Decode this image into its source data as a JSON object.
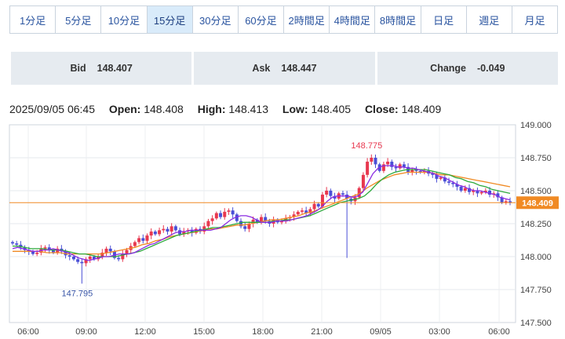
{
  "tabs": [
    {
      "label": "1分足",
      "active": false
    },
    {
      "label": "5分足",
      "active": false
    },
    {
      "label": "10分足",
      "active": false
    },
    {
      "label": "15分足",
      "active": true
    },
    {
      "label": "30分足",
      "active": false
    },
    {
      "label": "60分足",
      "active": false
    },
    {
      "label": "2時間足",
      "active": false
    },
    {
      "label": "4時間足",
      "active": false
    },
    {
      "label": "8時間足",
      "active": false
    },
    {
      "label": "日足",
      "active": false
    },
    {
      "label": "週足",
      "active": false
    },
    {
      "label": "月足",
      "active": false
    }
  ],
  "quote": {
    "bid_label": "Bid",
    "bid_value": "148.407",
    "ask_label": "Ask",
    "ask_value": "148.447",
    "change_label": "Change",
    "change_value": "-0.049"
  },
  "ohlc": {
    "datetime": "2025/09/05 06:45",
    "open_label": "Open:",
    "open_value": "148.408",
    "high_label": "High:",
    "high_value": "148.413",
    "low_label": "Low:",
    "low_value": "148.405",
    "close_label": "Close:",
    "close_value": "148.409"
  },
  "chart_data": {
    "type": "candlestick",
    "y_ticks": [
      "149.000",
      "148.750",
      "148.500",
      "148.250",
      "148.000",
      "147.750",
      "147.500"
    ],
    "ylim": [
      147.5,
      149.0
    ],
    "x_ticks": [
      "06:00",
      "09:00",
      "12:00",
      "15:00",
      "18:00",
      "21:00",
      "09/05",
      "03:00",
      "06:00"
    ],
    "current_price_label": "148.409",
    "current_price": 148.409,
    "annotations": [
      {
        "text": "148.775",
        "value": 148.775,
        "kind": "high"
      },
      {
        "text": "147.795",
        "value": 147.795,
        "kind": "low"
      }
    ],
    "colors": {
      "up": "#e8384f",
      "down": "#4a4fd6",
      "ma_short": "#8a2be2",
      "ma_mid": "#2eaa3c",
      "ma_long": "#f08a24",
      "price_line": "#f08a24"
    },
    "closes": [
      148.1,
      148.09,
      148.07,
      148.05,
      148.04,
      148.02,
      148.03,
      148.06,
      148.07,
      148.05,
      148.03,
      148.06,
      148.04,
      148.01,
      148.0,
      147.98,
      147.96,
      147.95,
      147.98,
      148.0,
      147.98,
      148.0,
      148.03,
      148.06,
      148.04,
      147.99,
      147.98,
      148.02,
      148.05,
      148.08,
      148.11,
      148.14,
      148.12,
      148.16,
      148.19,
      148.17,
      148.2,
      148.21,
      148.19,
      148.23,
      148.2,
      148.17,
      148.19,
      148.2,
      148.18,
      148.21,
      148.19,
      148.23,
      148.27,
      148.29,
      148.33,
      148.3,
      148.34,
      148.35,
      148.32,
      148.27,
      148.23,
      148.21,
      148.25,
      148.28,
      148.26,
      148.3,
      148.27,
      148.25,
      148.28,
      148.26,
      148.27,
      148.29,
      148.3,
      148.32,
      148.34,
      148.35,
      148.33,
      148.36,
      148.4,
      148.38,
      148.47,
      148.5,
      148.46,
      148.44,
      148.48,
      148.47,
      148.44,
      148.42,
      148.45,
      148.52,
      148.62,
      148.72,
      148.75,
      148.7,
      148.65,
      148.7,
      148.72,
      148.68,
      148.67,
      148.7,
      148.68,
      148.64,
      148.66,
      148.65,
      148.64,
      148.65,
      148.63,
      148.62,
      148.59,
      148.6,
      148.57,
      148.56,
      148.55,
      148.53,
      148.5,
      148.52,
      148.49,
      148.5,
      148.48,
      148.49,
      148.5,
      148.47,
      148.48,
      148.45,
      148.41,
      148.42,
      148.41
    ],
    "ma_short": [
      148.06,
      148.07,
      148.06,
      148.05,
      148.04,
      148.04,
      148.05,
      148.05,
      148.06,
      148.05,
      148.04,
      148.03,
      148.01,
      147.99,
      147.98,
      147.97,
      147.98,
      147.99,
      148.0,
      148.0,
      148.01,
      148.02,
      148.02,
      148.02,
      148.03,
      148.05,
      148.07,
      148.09,
      148.1,
      148.12,
      148.14,
      148.16,
      148.18,
      148.19,
      148.19,
      148.2,
      148.2,
      148.2,
      148.2,
      148.2,
      148.21,
      148.22,
      148.25,
      148.28,
      148.3,
      148.31,
      148.31,
      148.3,
      148.28,
      148.26,
      148.26,
      148.26,
      148.27,
      148.27,
      148.27,
      148.28,
      148.29,
      148.3,
      148.31,
      148.33,
      148.35,
      148.38,
      148.42,
      148.45,
      148.46,
      148.46,
      148.46,
      148.45,
      148.46,
      148.49,
      148.56,
      148.63,
      148.67,
      148.69,
      148.69,
      148.69,
      148.68,
      148.68,
      148.67,
      148.67,
      148.66,
      148.65,
      148.64,
      148.63,
      148.61,
      148.6,
      148.58,
      148.56,
      148.54,
      148.53,
      148.51,
      148.5,
      148.5,
      148.49,
      148.48,
      148.47,
      148.45,
      148.44,
      148.43
    ],
    "ma_mid": [
      148.08,
      148.08,
      148.07,
      148.06,
      148.06,
      148.06,
      148.05,
      148.05,
      148.05,
      148.04,
      148.03,
      148.02,
      148.02,
      148.01,
      148.0,
      148.0,
      148.0,
      148.0,
      148.01,
      148.02,
      148.03,
      148.04,
      148.06,
      148.08,
      148.1,
      148.12,
      148.14,
      148.16,
      148.17,
      148.18,
      148.19,
      148.2,
      148.21,
      148.22,
      148.22,
      148.23,
      148.24,
      148.25,
      148.26,
      148.26,
      148.26,
      148.26,
      148.26,
      148.27,
      148.27,
      148.28,
      148.28,
      148.29,
      148.3,
      148.31,
      148.33,
      148.35,
      148.37,
      148.39,
      148.41,
      148.42,
      148.43,
      148.44,
      148.46,
      148.5,
      148.55,
      148.59,
      148.62,
      148.64,
      148.65,
      148.66,
      148.66,
      148.66,
      148.66,
      148.65,
      148.64,
      148.63,
      148.62,
      148.6,
      148.59,
      148.57,
      148.56,
      148.54,
      148.53,
      148.51,
      148.5,
      148.49,
      148.48
    ],
    "ma_long": [
      148.04,
      148.04,
      148.04,
      148.04,
      148.04,
      148.03,
      148.03,
      148.03,
      148.02,
      148.02,
      148.02,
      148.02,
      148.02,
      148.02,
      148.03,
      148.04,
      148.05,
      148.06,
      148.07,
      148.09,
      148.1,
      148.12,
      148.13,
      148.15,
      148.16,
      148.17,
      148.18,
      148.19,
      148.2,
      148.21,
      148.21,
      148.22,
      148.23,
      148.24,
      148.24,
      148.25,
      148.26,
      148.27,
      148.28,
      148.28,
      148.29,
      148.3,
      148.31,
      148.33,
      148.34,
      148.36,
      148.38,
      148.4,
      148.42,
      148.44,
      148.46,
      148.48,
      148.52,
      148.55,
      148.58,
      148.6,
      148.62,
      148.63,
      148.64,
      148.64,
      148.64,
      148.64,
      148.63,
      148.62,
      148.62,
      148.61,
      148.6,
      148.59,
      148.58,
      148.57,
      148.56,
      148.55,
      148.54,
      148.53
    ]
  }
}
